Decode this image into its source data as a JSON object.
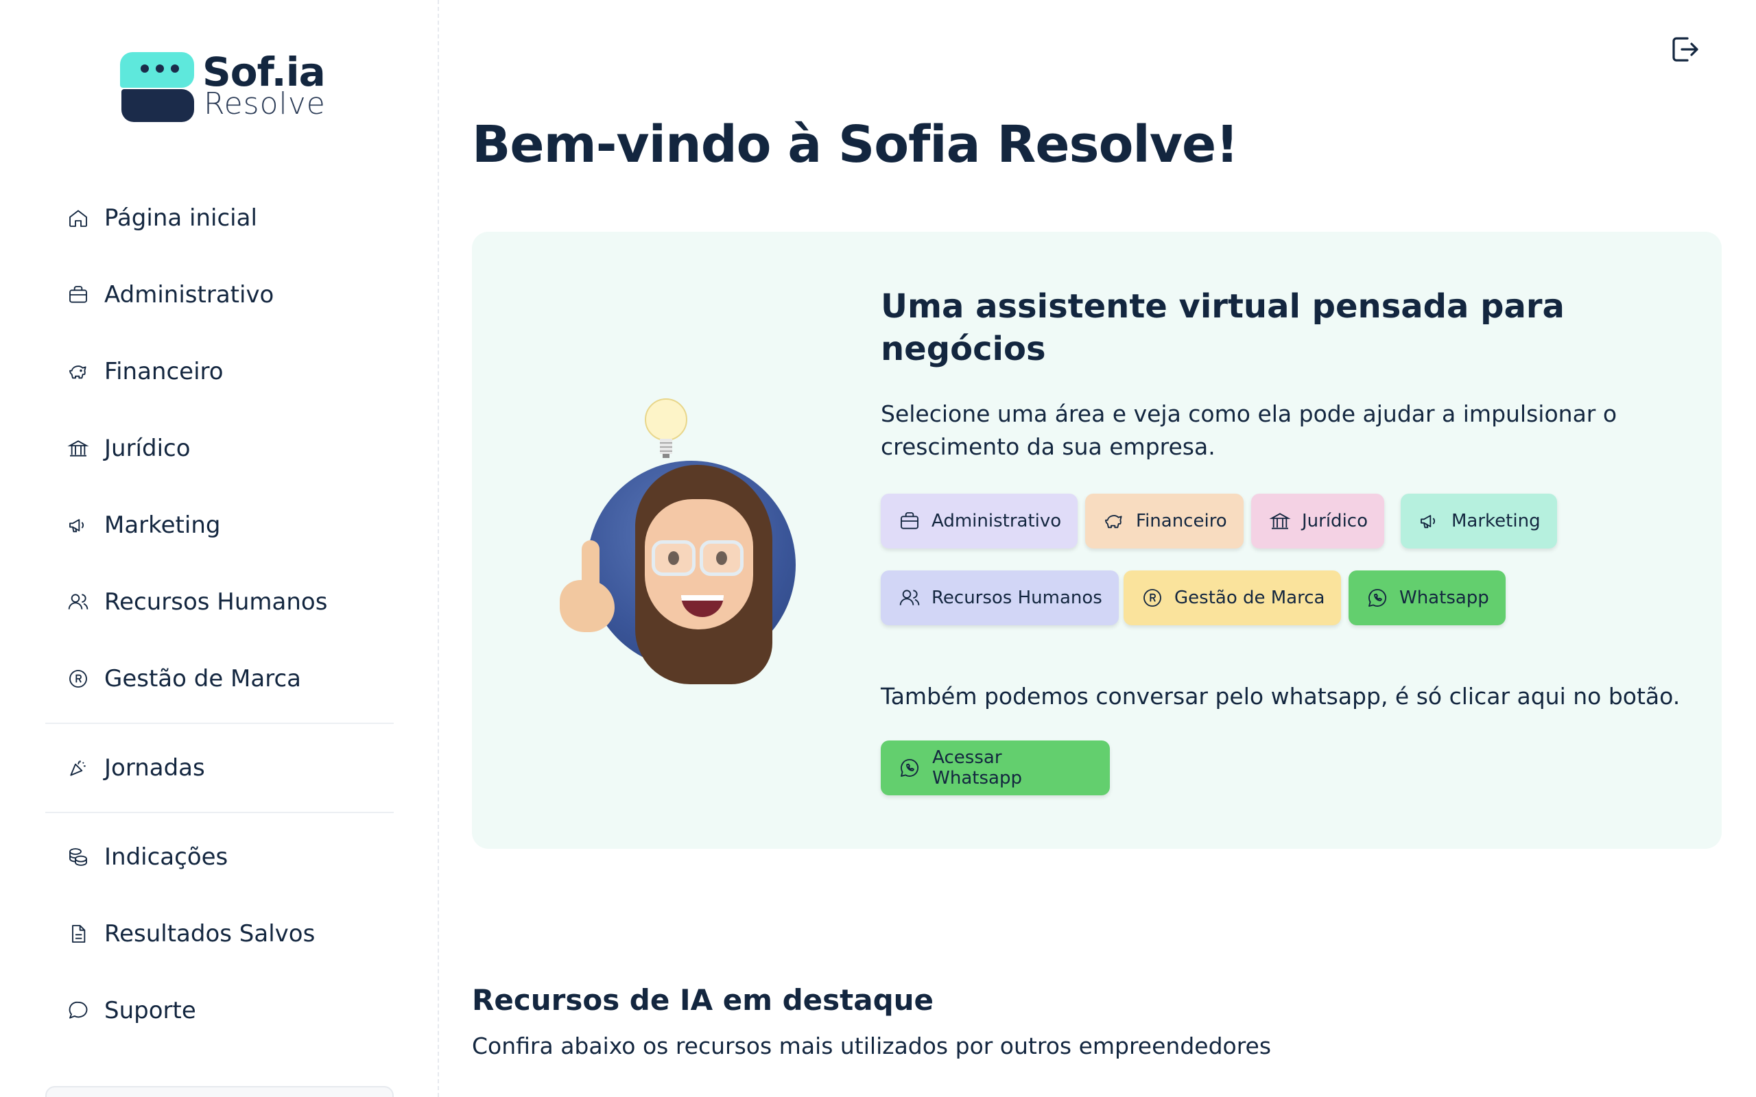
{
  "brand": {
    "name": "Sof.ia",
    "tagline": "Resolve"
  },
  "sidebar": {
    "items": [
      {
        "label": "Página inicial",
        "icon": "home-icon"
      },
      {
        "label": "Administrativo",
        "icon": "briefcase-icon"
      },
      {
        "label": "Financeiro",
        "icon": "piggy-bank-icon"
      },
      {
        "label": "Jurídico",
        "icon": "bank-building-icon"
      },
      {
        "label": "Marketing",
        "icon": "megaphone-icon"
      },
      {
        "label": "Recursos Humanos",
        "icon": "users-icon"
      },
      {
        "label": "Gestão de Marca",
        "icon": "registered-mark-icon"
      },
      {
        "label": "Jornadas",
        "icon": "party-popper-icon"
      },
      {
        "label": "Indicações",
        "icon": "coins-icon"
      },
      {
        "label": "Resultados Salvos",
        "icon": "document-icon"
      },
      {
        "label": "Suporte",
        "icon": "chat-bubble-icon"
      }
    ]
  },
  "header": {
    "logout_icon": "logout-icon"
  },
  "main": {
    "title": "Bem-vindo à Sofia Resolve!",
    "hero": {
      "heading": "Uma assistente virtual pensada para negócios",
      "text": "Selecione uma área e veja como ela pode ajudar a impulsionar o crescimento da sua empresa.",
      "chips": [
        {
          "label": "Administrativo",
          "icon": "briefcase-icon",
          "color": "#e0dcf8"
        },
        {
          "label": "Financeiro",
          "icon": "piggy-bank-icon",
          "color": "#f8dcc0"
        },
        {
          "label": "Jurídico",
          "icon": "bank-building-icon",
          "color": "#f4d2e4"
        },
        {
          "label": "Marketing",
          "icon": "megaphone-icon",
          "color": "#b6f0de"
        },
        {
          "label": "Recursos Humanos",
          "icon": "users-icon",
          "color": "#d2d6f6"
        },
        {
          "label": "Gestão de Marca",
          "icon": "registered-mark-icon",
          "color": "#fae39c"
        },
        {
          "label": "Whatsapp",
          "icon": "whatsapp-icon",
          "color": "#63cf6e"
        }
      ],
      "whatsapp_text": "Também podemos conversar pelo whatsapp, é só clicar aqui no botão.",
      "cta_label": "Acessar Whatsapp"
    },
    "featured": {
      "title": "Recursos de IA em destaque",
      "subtitle": "Confira abaixo os recursos mais utilizados por outros empreendedores"
    }
  }
}
